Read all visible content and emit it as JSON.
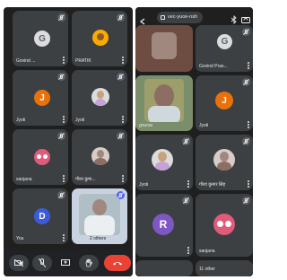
{
  "left_screen": {
    "participants": [
      {
        "name": "Govind ...",
        "initial": "G",
        "avatar_color": "#dadce0"
      },
      {
        "name": "PRATIK",
        "initial": "",
        "avatar_color": "#f9ab00"
      },
      {
        "name": "Jyoti",
        "initial": "J",
        "avatar_color": "#e8710a"
      },
      {
        "name": "Jyoti",
        "initial": "",
        "avatar_color": "#c5a3d8"
      },
      {
        "name": "sanjana",
        "initial": "",
        "avatar_color": "#e05a7a"
      },
      {
        "name": "गौरव कुमा...",
        "initial": "",
        "avatar_color": "#c8b09a"
      },
      {
        "name": "You",
        "initial": "D",
        "avatar_color": "#3b5bdb"
      },
      {
        "name": "2 others",
        "initial": "",
        "avatar_color": "#9aa0a6"
      }
    ]
  },
  "right_screen": {
    "meeting_code": "vec-yuoe-nsh",
    "participants": [
      {
        "name": "Govind Pras...",
        "initial": "G",
        "avatar_color": "#dadce0"
      },
      {
        "name": "gourav",
        "initial": "",
        "avatar_color": "#8d6e63"
      },
      {
        "name": "Jyoti",
        "initial": "J",
        "avatar_color": "#e8710a"
      },
      {
        "name": "Jyoti",
        "initial": "",
        "avatar_color": "#c5a3d8"
      },
      {
        "name": "गौरव कुमार सिंह",
        "initial": "",
        "avatar_color": "#c8b09a"
      },
      {
        "name": "",
        "initial": "R",
        "avatar_color": "#7e57c2"
      },
      {
        "name": "sanjana",
        "initial": "",
        "avatar_color": "#e05a7a"
      },
      {
        "name": "11 other",
        "initial": "",
        "avatar_color": "#5f6368"
      }
    ]
  },
  "colors": {
    "end_call": "#ea4335",
    "tile_bg": "#3c4043",
    "screen_bg": "#1f1f1f"
  }
}
